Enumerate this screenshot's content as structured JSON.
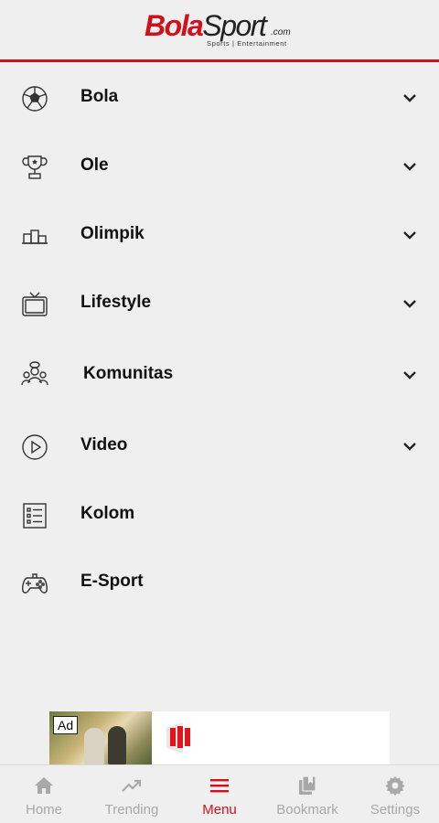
{
  "header": {
    "logo_part1": "Bola",
    "logo_part2": "Sport",
    "logo_suffix": ".com",
    "logo_tagline": "Sports | Entertainment",
    "accent_color": "#d0111b"
  },
  "menu": {
    "items": [
      {
        "label": "Bola",
        "icon": "soccer-ball-icon",
        "expandable": true
      },
      {
        "label": "Ole",
        "icon": "trophy-icon",
        "expandable": true
      },
      {
        "label": "Olimpik",
        "icon": "podium-icon",
        "expandable": true
      },
      {
        "label": "Lifestyle",
        "icon": "tv-icon",
        "expandable": true
      },
      {
        "label": "Komunitas",
        "icon": "community-icon",
        "expandable": true
      },
      {
        "label": "Video",
        "icon": "play-circle-icon",
        "expandable": true
      },
      {
        "label": "Kolom",
        "icon": "checklist-icon",
        "expandable": false
      },
      {
        "label": "E-Sport",
        "icon": "gamepad-icon",
        "expandable": false
      }
    ]
  },
  "ad": {
    "tag": "Ad"
  },
  "bottom_nav": {
    "items": [
      {
        "label": "Home",
        "icon": "home-icon",
        "active": false
      },
      {
        "label": "Trending",
        "icon": "trending-icon",
        "active": false
      },
      {
        "label": "Menu",
        "icon": "menu-icon",
        "active": true
      },
      {
        "label": "Bookmark",
        "icon": "bookmark-icon",
        "active": false
      },
      {
        "label": "Settings",
        "icon": "settings-icon",
        "active": false
      }
    ]
  }
}
